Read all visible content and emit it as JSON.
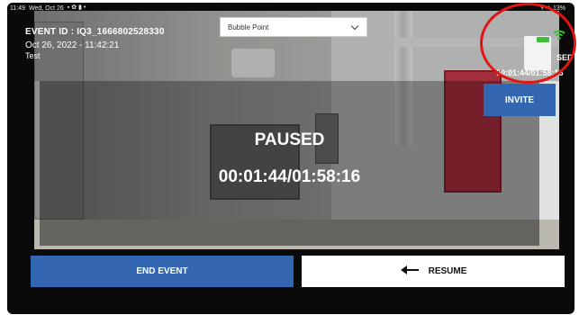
{
  "status_bar": {
    "time": "11:49",
    "date": "Wed, Oct 26",
    "battery": "13%"
  },
  "event": {
    "id_label": "EVENT ID : IQ3_1666802528330",
    "datetime": "Oct 26, 2022 - 11:42:21",
    "note": "Test"
  },
  "dropdown": {
    "selected": "Bubble Point"
  },
  "recording": {
    "status_fragment": "SED",
    "corner_timer": "00:01:44/01:58:16"
  },
  "buttons": {
    "invite": "INVITE",
    "end_event": "END EVENT",
    "resume": "RESUME"
  },
  "overlay": {
    "state": "PAUSED",
    "timer": "00:01:44/01:58:16"
  },
  "colors": {
    "accent": "#3367b2",
    "signal": "#37c02f",
    "annotation": "#e21414"
  },
  "icons": {
    "resume": "arrow-left-icon",
    "signal": "wifi-icon",
    "dropdown": "chevron-down-icon"
  }
}
